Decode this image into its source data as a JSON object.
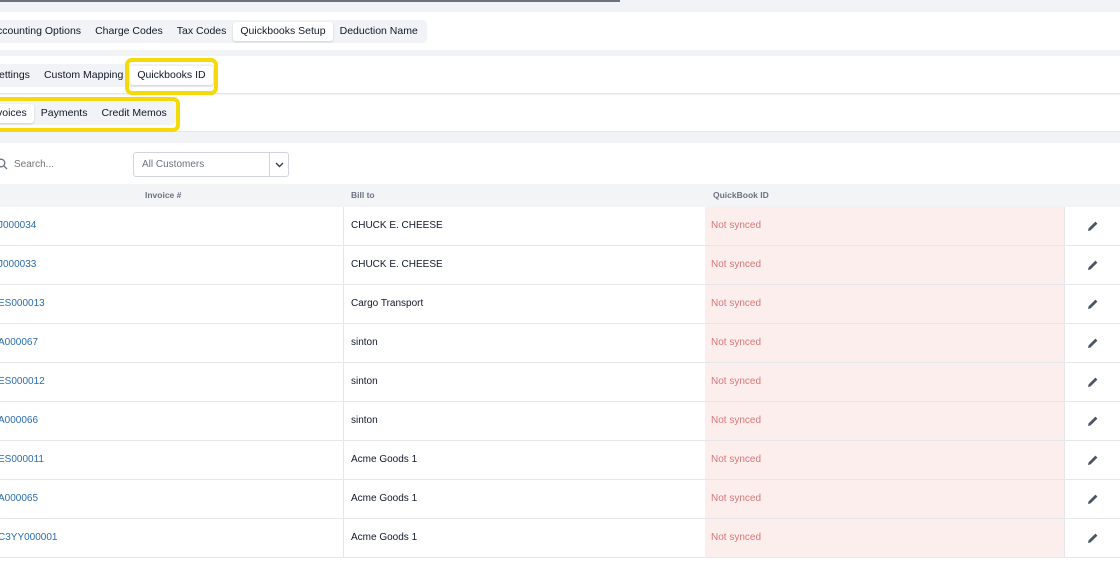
{
  "tabs_level1": {
    "items": [
      "ccounting Options",
      "Charge Codes",
      "Tax Codes",
      "Quickbooks Setup",
      "Deduction Name"
    ],
    "active": 3
  },
  "tabs_level2": {
    "items": [
      "ettings",
      "Custom Mapping",
      "Quickbooks ID"
    ],
    "active": 2
  },
  "tabs_level3": {
    "items": [
      "voices",
      "Payments",
      "Credit Memos"
    ],
    "active": 0
  },
  "filters": {
    "search_placeholder": "Search...",
    "customer_select": "All Customers"
  },
  "table": {
    "headers": {
      "invoice": "Invoice #",
      "bill_to": "Bill to",
      "quickbook_id": "QuickBook ID"
    },
    "rows": [
      {
        "invoice": "J000034",
        "bill_to": "CHUCK E. CHEESE",
        "quickbook_id": "Not synced"
      },
      {
        "invoice": "J000033",
        "bill_to": "CHUCK E. CHEESE",
        "quickbook_id": "Not synced"
      },
      {
        "invoice": "ES000013",
        "bill_to": "Cargo Transport",
        "quickbook_id": "Not synced"
      },
      {
        "invoice": "A000067",
        "bill_to": "sinton",
        "quickbook_id": "Not synced"
      },
      {
        "invoice": "ES000012",
        "bill_to": "sinton",
        "quickbook_id": "Not synced"
      },
      {
        "invoice": "A000066",
        "bill_to": "sinton",
        "quickbook_id": "Not synced"
      },
      {
        "invoice": "ES000011",
        "bill_to": "Acme Goods 1",
        "quickbook_id": "Not synced"
      },
      {
        "invoice": "A000065",
        "bill_to": "Acme Goods 1",
        "quickbook_id": "Not synced"
      },
      {
        "invoice": "C3YY000001",
        "bill_to": "Acme Goods 1",
        "quickbook_id": "Not synced"
      }
    ]
  },
  "icons": {
    "search": "search-icon",
    "caret": "chevron-down-icon",
    "edit": "pencil-icon"
  },
  "colors": {
    "link": "#2b6cb0",
    "not_synced_bg": "#fdeeee",
    "not_synced_text": "#d97777",
    "highlight": "#f5d90a"
  }
}
